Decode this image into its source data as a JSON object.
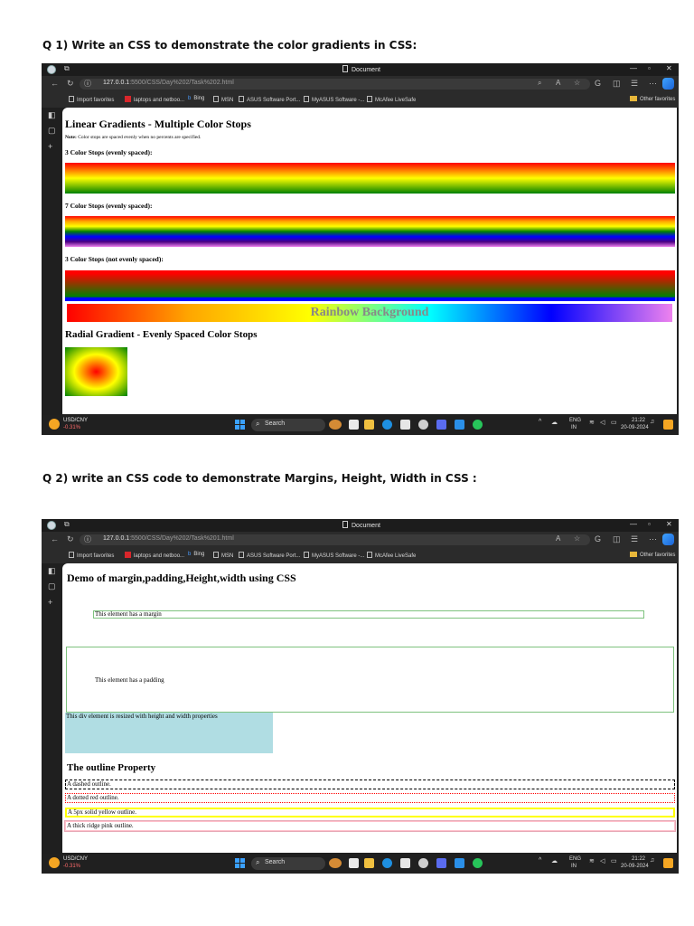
{
  "questions": {
    "q1": "Q 1) Write an CSS to demonstrate the color gradients in CSS:",
    "q2": "Q 2) write an CSS code to demonstrate Margins, Height, Width in CSS :"
  },
  "browser": {
    "tab_title": "Document",
    "urls": {
      "shot1_host": "127.0.0.1",
      "shot1_path": ":5500/CSS/Day%202/Task%202.html",
      "shot2_host": "127.0.0.1",
      "shot2_path": ":5500/CSS/Day%202/Task%201.html"
    },
    "bookmarks": [
      "Import favorites",
      "laptops and netboo...",
      "Bing",
      "MSN",
      "ASUS Software Port...",
      "MyASUS Software -...",
      "McAfee LiveSafe"
    ],
    "other_favorites": "Other favorites"
  },
  "taskbar": {
    "ticker": "USD/CNY",
    "change": "-0.31%",
    "search": "Search",
    "lang_top": "ENG",
    "lang_bottom": "IN",
    "time": "21:22",
    "date": "20-09-2024"
  },
  "page1": {
    "heading": "Linear Gradients - Multiple Color Stops",
    "note_label": "Note:",
    "note_text": " Color stops are spaced evenly when no percents are specified.",
    "sec1": "3 Color Stops (evenly spaced):",
    "sec2": "7 Color Stops (evenly spaced):",
    "sec3": "3 Color Stops (not evenly spaced):",
    "rainbow": "Rainbow Background",
    "radial_heading": "Radial Gradient - Evenly Spaced Color Stops"
  },
  "page2": {
    "heading": "Demo of margin,padding,Height,width using CSS",
    "margin_text": "This element has a margin",
    "padding_text": "This element has a padding",
    "hw_text": "This div element is resized with height and width properties",
    "outline_heading": "The outline Property",
    "outlines": [
      "A dashed outline.",
      "A dotted red outline.",
      "A 5px solid yellow outline.",
      "A thick ridge pink outline."
    ]
  }
}
